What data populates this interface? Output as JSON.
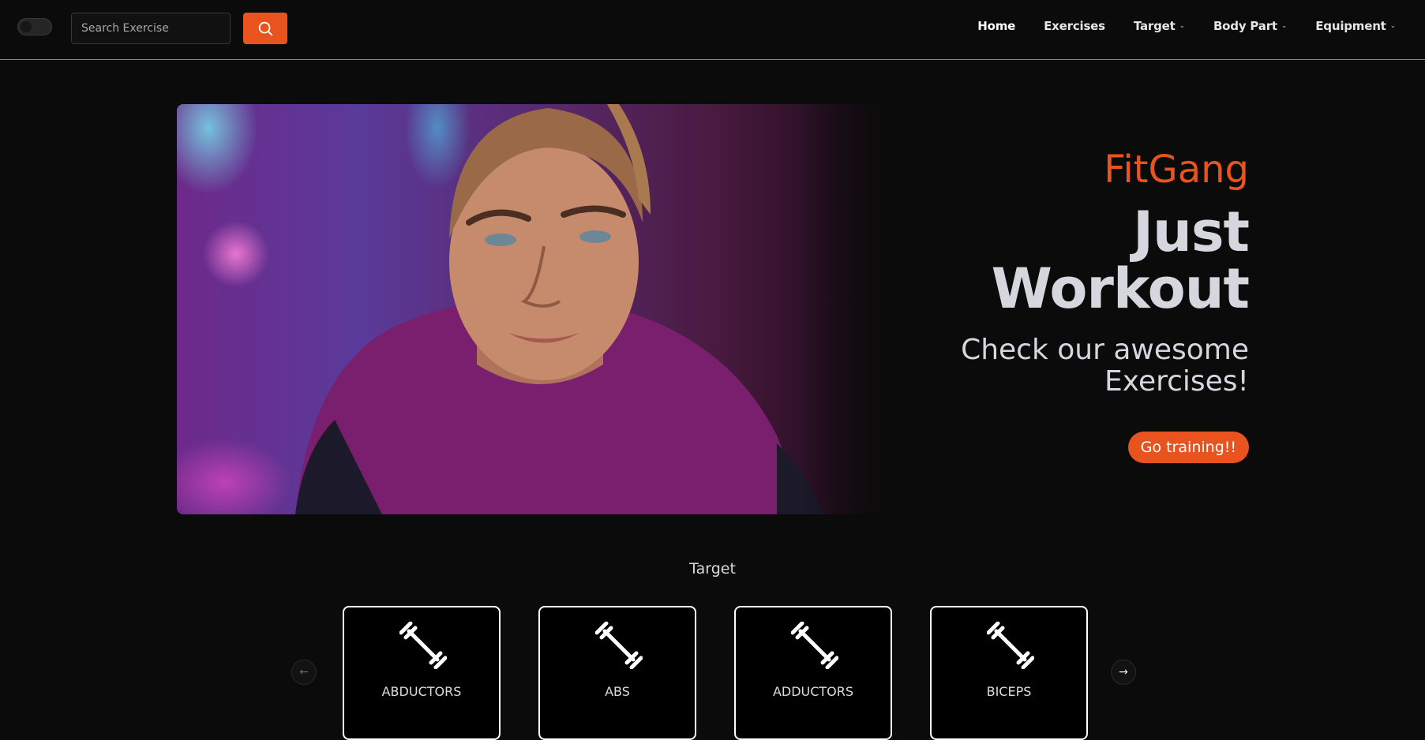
{
  "header": {
    "search_placeholder": "Search Exercise",
    "nav": [
      {
        "label": "Home",
        "active": true,
        "dropdown": false
      },
      {
        "label": "Exercises",
        "active": false,
        "dropdown": false
      },
      {
        "label": "Target",
        "active": false,
        "dropdown": true
      },
      {
        "label": "Body Part",
        "active": false,
        "dropdown": true
      },
      {
        "label": "Equipment",
        "active": false,
        "dropdown": true
      }
    ]
  },
  "hero": {
    "brand": "FitGang",
    "headline_line1": "Just",
    "headline_line2": "Workout",
    "sub_line1": "Check our awesome",
    "sub_line2": "Exercises!",
    "cta": "Go training!!"
  },
  "target": {
    "title": "Target",
    "cards": [
      {
        "label": "ABDUCTORS",
        "icon": "dumbbell-icon"
      },
      {
        "label": "ABS",
        "icon": "dumbbell-icon"
      },
      {
        "label": "ADDUCTORS",
        "icon": "dumbbell-icon"
      },
      {
        "label": "BICEPS",
        "icon": "dumbbell-icon"
      }
    ]
  },
  "colors": {
    "accent": "#e9531e",
    "background": "#0b0b0b",
    "text": "#d6d6de"
  },
  "icons": {
    "search": "search-icon",
    "prev": "arrow-left-icon",
    "next": "arrow-right-icon",
    "chevron": "chevron-down-icon"
  }
}
